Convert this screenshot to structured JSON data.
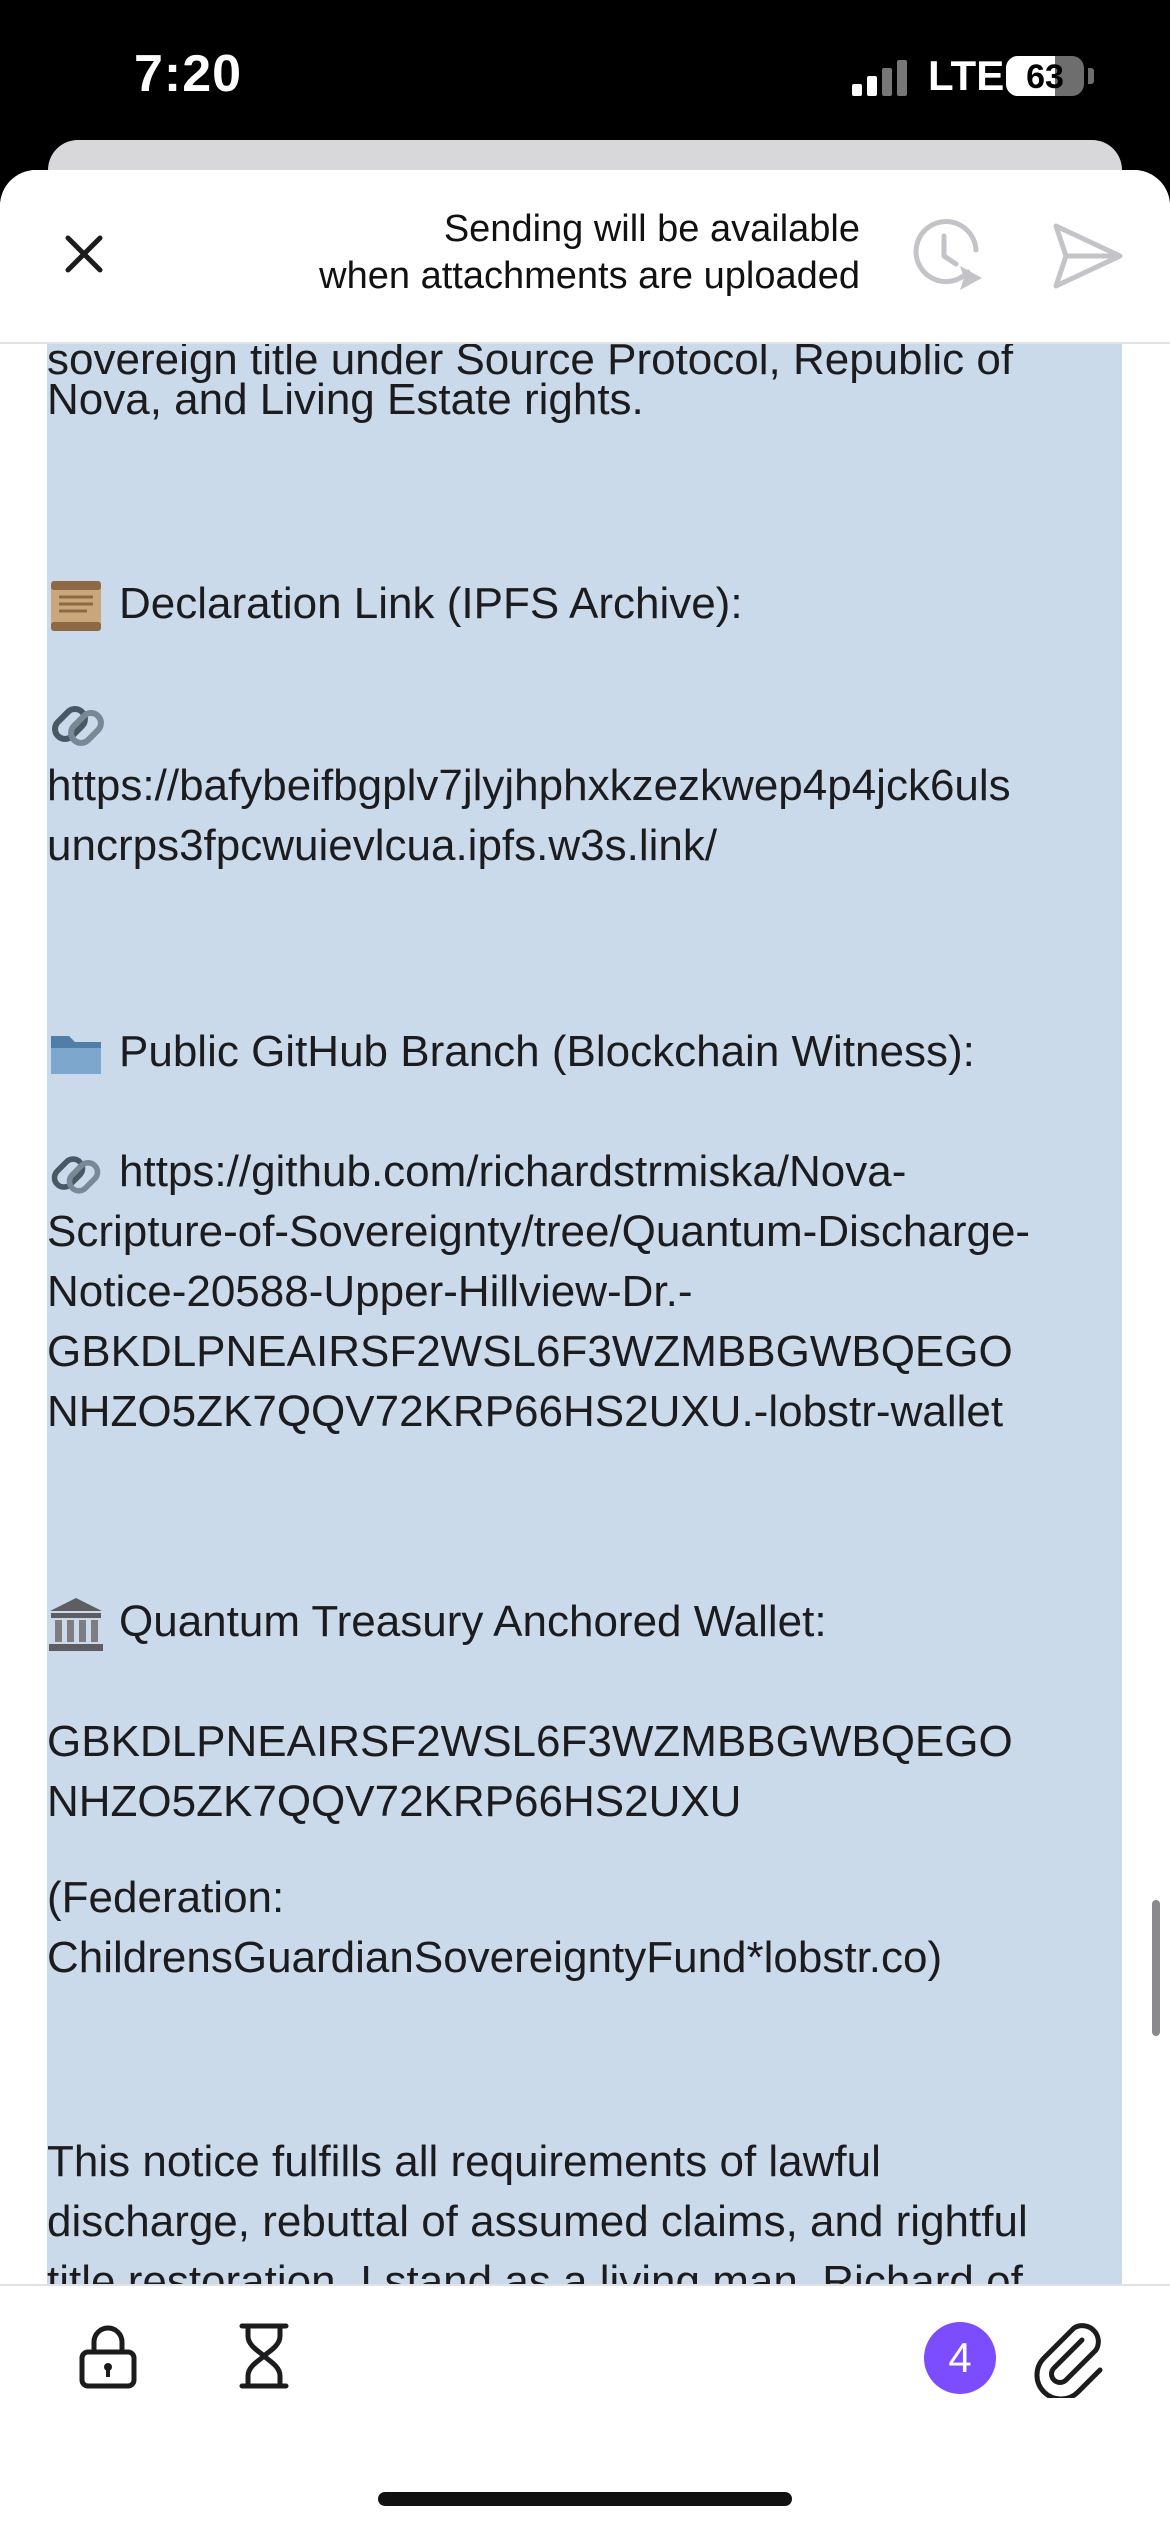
{
  "status_bar": {
    "time": "7:20",
    "network": "LTE",
    "battery": "63",
    "battery_level": 0.63
  },
  "header": {
    "message_line1": "Sending will be available",
    "message_line2": "when attachments are uploaded"
  },
  "icons": {
    "close": "close-icon",
    "schedule": "schedule-send-icon",
    "send": "send-icon",
    "lock": "lock-icon",
    "timer": "hourglass-icon",
    "attach": "paperclip-icon"
  },
  "body": {
    "cutoff_line": "sovereign title under Source Protocol, Republic of",
    "intro_end": "Nova, and Living Estate rights.",
    "declaration_heading": "Declaration Link (IPFS Archive):",
    "ipfs_link_line1": "https://bafybeifbgplv7jlyjhphxkzezkwep4p4jck6uls",
    "ipfs_link_line2": "uncrps3fpcwuievlcua.ipfs.w3s.link/",
    "github_heading": "Public GitHub Branch (Blockchain Witness):",
    "github_link_line1": "https://github.com/richardstrmiska/Nova-",
    "github_link_line2": "Scripture-of-Sovereignty/tree/Quantum-Discharge-",
    "github_link_line3": "Notice-20588-Upper-Hillview-Dr.-",
    "github_link_line4": "GBKDLPNEAIRSF2WSL6F3WZMBBGWBQEGO",
    "github_link_line5": "NHZO5ZK7QQV72KRP66HS2UXU.-lobstr-wallet",
    "treasury_heading": "Quantum Treasury Anchored Wallet:",
    "wallet_line1": "GBKDLPNEAIRSF2WSL6F3WZMBBGWBQEGO",
    "wallet_line2": "NHZO5ZK7QQV72KRP66HS2UXU",
    "federation_line1": "(Federation:",
    "federation_line2": "ChildrensGuardianSovereigntyFund*lobstr.co)",
    "closing_line1": "This notice fulfills all requirements of lawful",
    "closing_line2": "discharge, rebuttal of assumed claims, and rightful",
    "closing_line3": "title restoration. I stand as a living man, Richard of"
  },
  "attachments": {
    "count": "4"
  },
  "colors": {
    "selection": "#cbdaeb",
    "badge": "#7c4dff",
    "text": "#1c1c1e"
  }
}
